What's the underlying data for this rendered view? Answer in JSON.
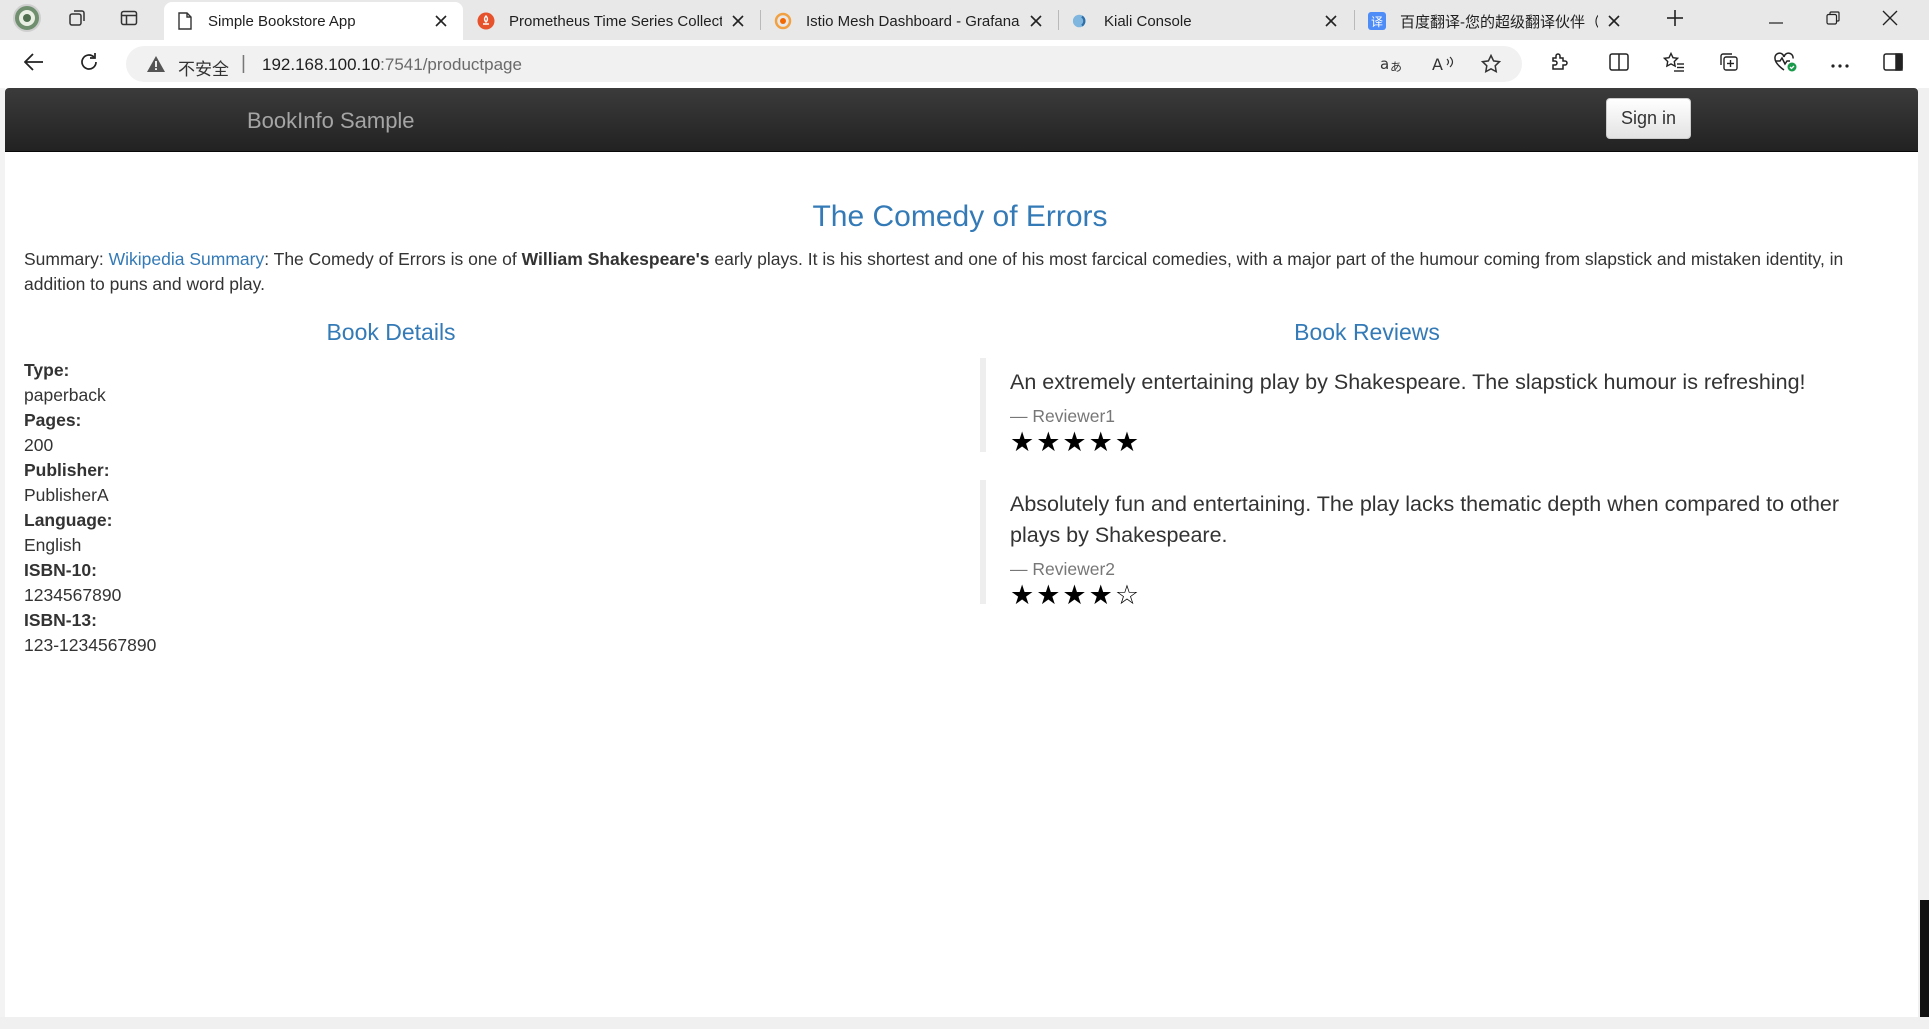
{
  "browser": {
    "tabs": [
      {
        "title": "Simple Bookstore App",
        "active": true,
        "icon": "page-icon"
      },
      {
        "title": "Prometheus Time Series Collecti",
        "active": false,
        "icon": "prometheus-icon"
      },
      {
        "title": "Istio Mesh Dashboard - Grafana",
        "active": false,
        "icon": "grafana-icon"
      },
      {
        "title": "Kiali Console",
        "active": false,
        "icon": "kiali-icon"
      },
      {
        "title": "百度翻译-您的超级翻译伙伴（文",
        "active": false,
        "icon": "baidu-translate-icon"
      }
    ],
    "address": {
      "security_label": "不安全",
      "url_host": "192.168.100.10",
      "url_rest": ":7541/productpage"
    },
    "colors": {
      "accent_link": "#337ab7",
      "navbar": "#222222"
    }
  },
  "app": {
    "brand": "BookInfo Sample",
    "signin_label": "Sign in"
  },
  "book": {
    "title": "The Comedy of Errors",
    "summary_prefix": "Summary: ",
    "summary_link": "Wikipedia Summary",
    "summary_mid": ": The Comedy of Errors is one of ",
    "summary_bold": "William Shakespeare's",
    "summary_rest": " early plays. It is his shortest and one of his most farcical comedies, with a major part of the humour coming from slapstick and mistaken identity, in addition to puns and word play."
  },
  "details": {
    "heading": "Book Details",
    "items": [
      {
        "label": "Type:",
        "value": "paperback"
      },
      {
        "label": "Pages:",
        "value": "200"
      },
      {
        "label": "Publisher:",
        "value": "PublisherA"
      },
      {
        "label": "Language:",
        "value": "English"
      },
      {
        "label": "ISBN-10:",
        "value": "1234567890"
      },
      {
        "label": "ISBN-13:",
        "value": "123-1234567890"
      }
    ]
  },
  "reviews": {
    "heading": "Book Reviews",
    "items": [
      {
        "text": "An extremely entertaining play by Shakespeare. The slapstick humour is refreshing!",
        "author": "— Reviewer1",
        "stars": "★★★★★",
        "rating": 5
      },
      {
        "text": "Absolutely fun and entertaining. The play lacks thematic depth when compared to other plays by Shakespeare.",
        "author": "— Reviewer2",
        "stars": "★★★★☆",
        "rating": 4
      }
    ]
  }
}
